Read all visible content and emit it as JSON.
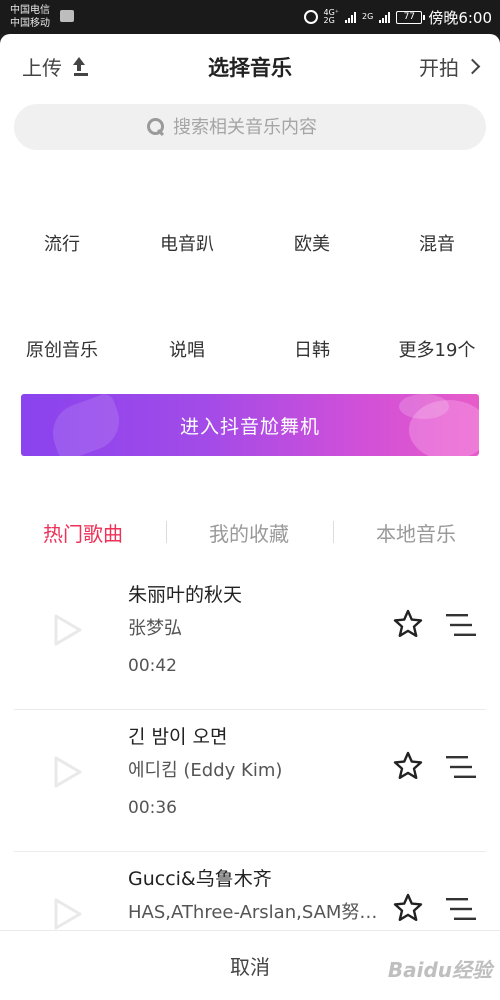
{
  "status_bar": {
    "carrier1": "中国电信",
    "carrier2": "中国移动",
    "network1": "4G⁺",
    "network1b": "2G",
    "network2": "2G",
    "battery": "77",
    "time": "傍晚6:00"
  },
  "header": {
    "upload_label": "上传",
    "title": "选择音乐",
    "shoot_label": "开拍"
  },
  "search": {
    "placeholder": "搜索相关音乐内容"
  },
  "categories": {
    "row1": [
      "流行",
      "电音趴",
      "欧美",
      "混音"
    ],
    "row2": [
      "原创音乐",
      "说唱",
      "日韩",
      "更多19个"
    ]
  },
  "banner": {
    "label": "进入抖音尬舞机"
  },
  "tabs": [
    "热门歌曲",
    "我的收藏",
    "本地音乐"
  ],
  "songs": [
    {
      "title": "朱丽叶的秋天",
      "artist": "张梦弘",
      "duration": "00:42"
    },
    {
      "title": "긴 밤이 오면",
      "artist": "에디킴 (Eddy Kim)",
      "duration": "00:36"
    },
    {
      "title": "Gucci&乌鲁木齐",
      "artist": "HAS,AThree-Arslan,SAM努…",
      "duration": ""
    }
  ],
  "bottom": {
    "cancel_label": "取消"
  },
  "watermark": "Baidu经验",
  "colors": {
    "accent": "#ee3158",
    "banner_start": "#8a43ee",
    "banner_end": "#e65cc9"
  }
}
